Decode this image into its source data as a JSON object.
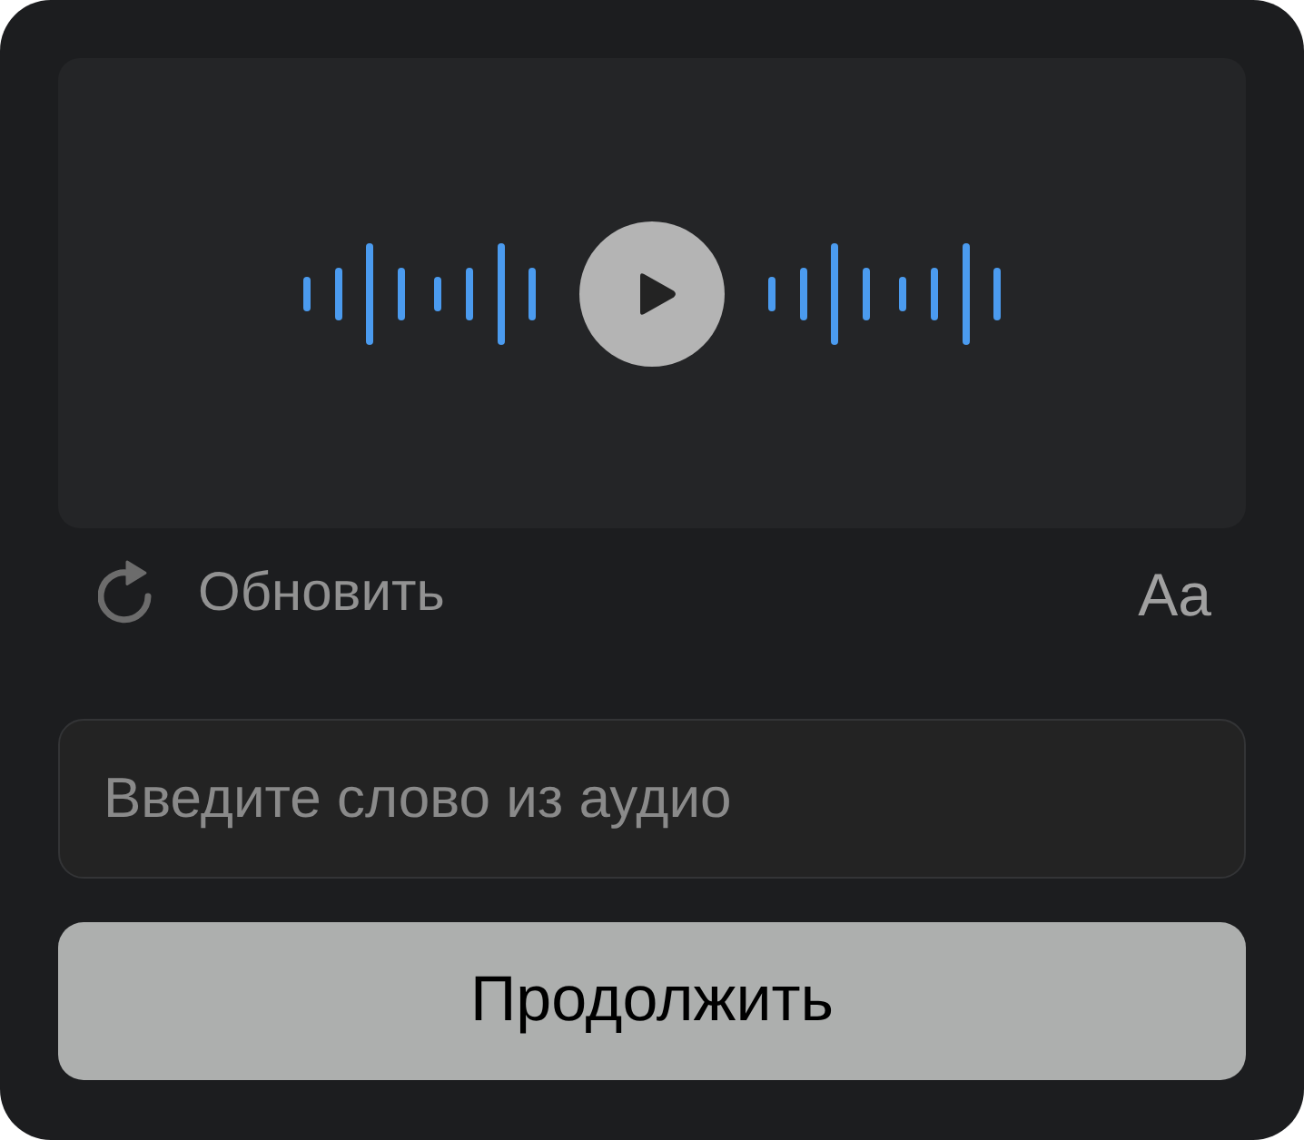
{
  "player": {
    "playing": false
  },
  "refresh_button": {
    "label": "Обновить"
  },
  "text_size_button": {
    "label": "Aa"
  },
  "answer_field": {
    "placeholder": "Введите слово из аудио"
  },
  "continue_button": {
    "label": "Продолжить"
  }
}
